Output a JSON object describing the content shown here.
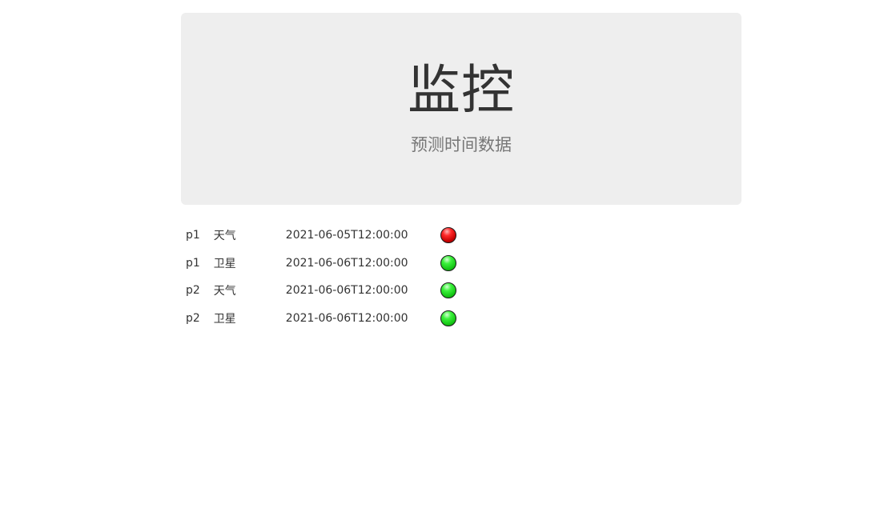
{
  "header": {
    "title": "监控",
    "subtitle": "预测时间数据"
  },
  "rows": [
    {
      "product": "p1",
      "type": "天气",
      "time": "2021-06-05T12:00:00",
      "status": "red",
      "status_icon": "red-light-icon"
    },
    {
      "product": "p1",
      "type": "卫星",
      "time": "2021-06-06T12:00:00",
      "status": "green",
      "status_icon": "green-light-icon"
    },
    {
      "product": "p2",
      "type": "天气",
      "time": "2021-06-06T12:00:00",
      "status": "green",
      "status_icon": "green-light-icon"
    },
    {
      "product": "p2",
      "type": "卫星",
      "time": "2021-06-06T12:00:00",
      "status": "green",
      "status_icon": "green-light-icon"
    }
  ],
  "colors": {
    "jumbotron_bg": "#eeeeee",
    "status_red": "#ff2a2a",
    "status_green": "#3cf23c"
  }
}
